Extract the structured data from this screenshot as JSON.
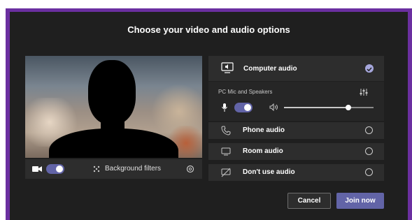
{
  "dialog": {
    "title": "Choose your video and audio options"
  },
  "video": {
    "camera_toggle_on": true,
    "background_filters_label": "Background filters"
  },
  "audio": {
    "options": [
      {
        "label": "Computer audio",
        "icon": "monitor-speaker-icon",
        "selected": true
      },
      {
        "label": "Phone audio",
        "icon": "phone-icon",
        "selected": false
      },
      {
        "label": "Room audio",
        "icon": "room-display-icon",
        "selected": false
      },
      {
        "label": "Don't use audio",
        "icon": "no-audio-icon",
        "selected": false
      }
    ],
    "device_label": "PC Mic and Speakers",
    "mic_toggle_on": true,
    "speaker_volume": 0.72
  },
  "buttons": {
    "cancel": "Cancel",
    "join": "Join now"
  },
  "colors": {
    "accent": "#6264a7",
    "frame": "#6b2fa0",
    "background": "#1f1f1f",
    "panel": "#2d2d2d"
  }
}
